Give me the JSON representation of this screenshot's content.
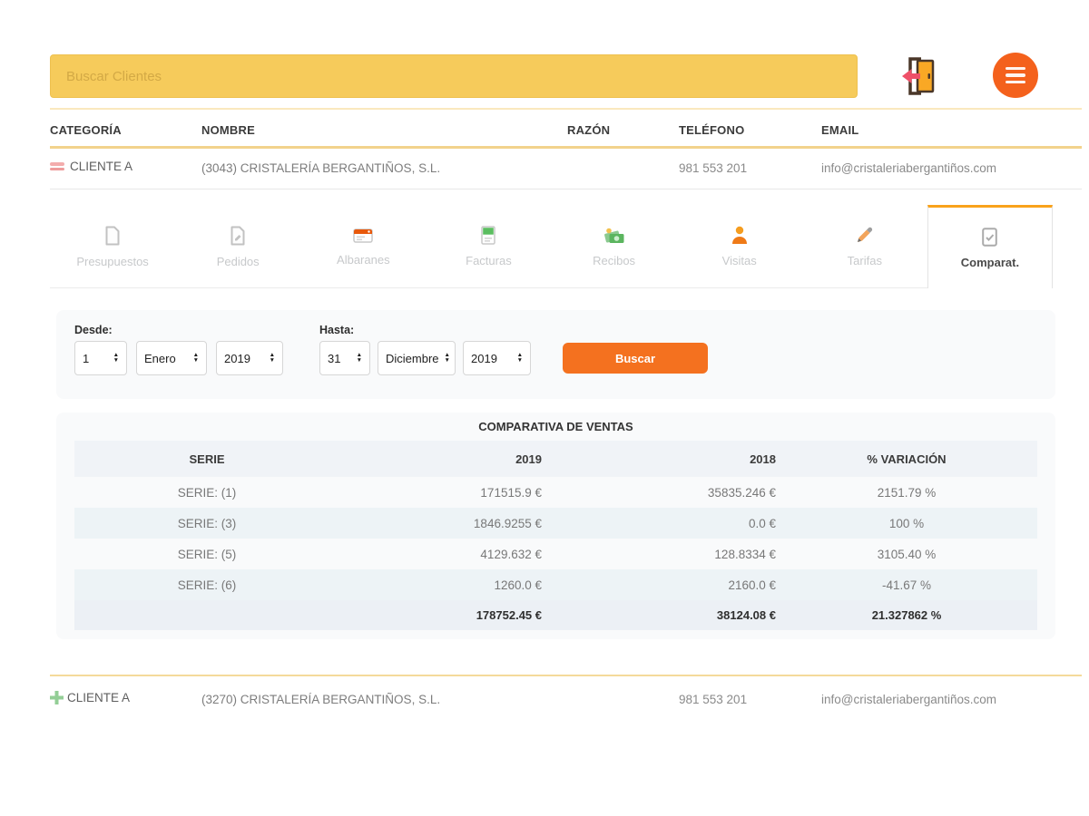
{
  "topbar": {
    "search_placeholder": "Buscar Clientes",
    "logout_icon": "exit-door-icon",
    "menu_icon": "hamburger-menu-icon"
  },
  "client_list": {
    "headers": {
      "category": "CATEGORÍA",
      "name": "NOMBRE",
      "razon": "RAZÓN",
      "phone": "TELÉFONO",
      "email": "EMAIL"
    },
    "selected_client": {
      "category_icon": "pink-dash-icon",
      "category": "CLIENTE A",
      "name": "(3043) CRISTALERÍA BERGANTIÑOS, S.L.",
      "phone": "981 553 201",
      "email": "info@cristaleriabergantiños.com"
    },
    "next_client": {
      "category_icon": "green-plus-icon",
      "category": "CLIENTE A",
      "name": "(3270) CRISTALERÍA BERGANTIÑOS, S.L.",
      "phone": "981 553 201",
      "email": "info@cristaleriabergantiños.com"
    }
  },
  "tabs": [
    {
      "label": "Presupuestos",
      "icon": "document-icon",
      "active": false
    },
    {
      "label": "Pedidos",
      "icon": "document-edit-icon",
      "active": false
    },
    {
      "label": "Albaranes",
      "icon": "delivery-note-icon",
      "active": false
    },
    {
      "label": "Facturas",
      "icon": "invoice-icon",
      "active": false
    },
    {
      "label": "Recibos",
      "icon": "money-icon",
      "active": false
    },
    {
      "label": "Visitas",
      "icon": "person-icon",
      "active": false
    },
    {
      "label": "Tarifas",
      "icon": "pencil-icon",
      "active": false
    },
    {
      "label": "Comparat.",
      "icon": "compare-document-icon",
      "active": true
    }
  ],
  "filters": {
    "desde_label": "Desde:",
    "hasta_label": "Hasta:",
    "desde_day": "1",
    "desde_month": "Enero",
    "desde_year": "2019",
    "hasta_day": "31",
    "hasta_month": "Diciembre",
    "hasta_year": "2019",
    "buscar_button": "Buscar"
  },
  "comparison": {
    "title": "COMPARATIVA DE VENTAS",
    "headers": {
      "serie": "SERIE",
      "col2019": "2019",
      "col2018": "2018",
      "variation": "% VARIACIÓN"
    },
    "rows": [
      {
        "serie": "SERIE: (1)",
        "v2019": "171515.9 €",
        "v2018": "35835.246 €",
        "variation": "2151.79 %"
      },
      {
        "serie": "SERIE: (3)",
        "v2019": "1846.9255 €",
        "v2018": "0.0 €",
        "variation": "100 %"
      },
      {
        "serie": "SERIE: (5)",
        "v2019": "4129.632 €",
        "v2018": "128.8334 €",
        "variation": "3105.40 %"
      },
      {
        "serie": "SERIE: (6)",
        "v2019": "1260.0 €",
        "v2018": "2160.0 €",
        "variation": "-41.67 %"
      }
    ],
    "totals": {
      "v2019": "178752.45 €",
      "v2018": "38124.08 €",
      "variation": "21.327862 %"
    }
  },
  "colors": {
    "search_bar_yellow": "#F6CB5B",
    "accent_orange": "#F4611C",
    "tab_active_border": "#F9A21B",
    "divider_yellow": "#F2D38C",
    "door_amber": "#F9A825",
    "arrow_red": "#EF5068",
    "green_plus": "#93CE96",
    "pink_dash": "#F3ADAD",
    "table_header_bg": "#F0F3F7"
  }
}
